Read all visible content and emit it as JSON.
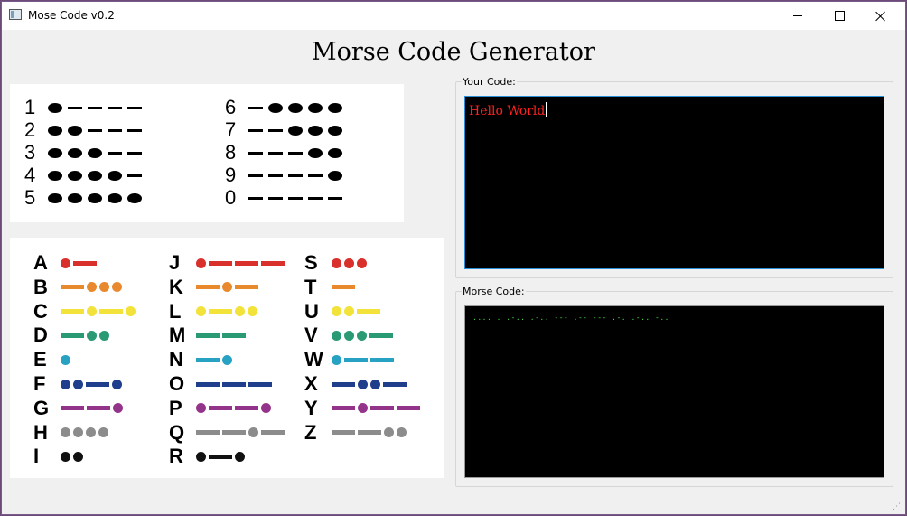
{
  "window": {
    "title": "Mose Code v0.2",
    "icon": "app-window-icon"
  },
  "heading": "Morse Code Generator",
  "digits_chart": [
    {
      "char": "1",
      "code": ".----"
    },
    {
      "char": "2",
      "code": "..---"
    },
    {
      "char": "3",
      "code": "...--"
    },
    {
      "char": "4",
      "code": "....-"
    },
    {
      "char": "5",
      "code": "....."
    },
    {
      "char": "6",
      "code": "-...."
    },
    {
      "char": "7",
      "code": "--..."
    },
    {
      "char": "8",
      "code": "---.."
    },
    {
      "char": "9",
      "code": "----."
    },
    {
      "char": "0",
      "code": "-----"
    }
  ],
  "letters_chart": [
    {
      "char": "A",
      "code": ".-",
      "color": "#d9302c"
    },
    {
      "char": "B",
      "code": "-...",
      "color": "#e8892e"
    },
    {
      "char": "C",
      "code": "-.-.",
      "color": "#f2e23a"
    },
    {
      "char": "D",
      "code": "-..",
      "color": "#2a9a74"
    },
    {
      "char": "E",
      "code": ".",
      "color": "#27a2c2"
    },
    {
      "char": "F",
      "code": "..-.",
      "color": "#1f3f8c"
    },
    {
      "char": "G",
      "code": "--.",
      "color": "#93338a"
    },
    {
      "char": "H",
      "code": "....",
      "color": "#8c8c8c"
    },
    {
      "char": "I",
      "code": "..",
      "color": "#111111"
    },
    {
      "char": "J",
      "code": ".---",
      "color": "#d9302c"
    },
    {
      "char": "K",
      "code": "-.-",
      "color": "#e8892e"
    },
    {
      "char": "L",
      "code": ".-..",
      "color": "#f2e23a"
    },
    {
      "char": "M",
      "code": "--",
      "color": "#2a9a74"
    },
    {
      "char": "N",
      "code": "-.",
      "color": "#27a2c2"
    },
    {
      "char": "O",
      "code": "---",
      "color": "#1f3f8c"
    },
    {
      "char": "P",
      "code": ".--.",
      "color": "#93338a"
    },
    {
      "char": "Q",
      "code": "--.-",
      "color": "#8c8c8c"
    },
    {
      "char": "R",
      "code": ".-.",
      "color": "#111111"
    },
    {
      "char": "S",
      "code": "...",
      "color": "#d9302c"
    },
    {
      "char": "T",
      "code": "-",
      "color": "#e8892e"
    },
    {
      "char": "U",
      "code": "..-",
      "color": "#f2e23a"
    },
    {
      "char": "V",
      "code": "...-",
      "color": "#2a9a74"
    },
    {
      "char": "W",
      "code": ".--",
      "color": "#27a2c2"
    },
    {
      "char": "X",
      "code": "-..-",
      "color": "#1f3f8c"
    },
    {
      "char": "Y",
      "code": "-.--",
      "color": "#93338a"
    },
    {
      "char": "Z",
      "code": "--..",
      "color": "#8c8c8c"
    }
  ],
  "your_code": {
    "label": "Your Code:",
    "value": "Hello World"
  },
  "morse_code": {
    "label": "Morse Code:",
    "value": ".... . .-.. .-.. --- .-- --- .-. .-.. -.."
  },
  "colors": {
    "input_text": "#ff2020",
    "output_text": "#4cd94c",
    "box_bg": "#000000"
  }
}
